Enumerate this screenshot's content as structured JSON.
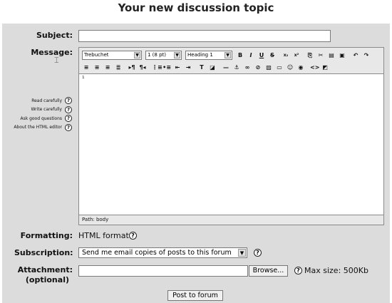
{
  "page": {
    "title": "Your new discussion topic"
  },
  "form": {
    "subject_label": "Subject:",
    "subject_value": "",
    "message_label": "Message:",
    "formatting_label": "Formatting:",
    "formatting_value": "HTML format",
    "subscription_label": "Subscription:",
    "subscription_value": "Send me email copies of posts to this forum",
    "attachment_label_1": "Attachment:",
    "attachment_label_2": "(optional)",
    "browse_label": "Browse...",
    "max_size": "Max size: 500Kb",
    "submit_label": "Post to forum"
  },
  "editor": {
    "font_family": "Trebuchet",
    "font_size": "1 (8 pt)",
    "heading": "Heading 1",
    "caret": "¹",
    "path": "Path:  body"
  },
  "help": {
    "items": [
      "Read carefully",
      "Write carefully",
      "Ask good questions",
      "About the HTML editor"
    ],
    "glyph": "?"
  },
  "icons": {
    "toolbar_row1": [
      "bold-icon",
      "italic-icon",
      "underline-icon",
      "strikethrough-icon",
      "subscript-icon",
      "superscript-icon",
      "copy-icon",
      "cut-icon",
      "paste-icon",
      "paste-word-icon",
      "undo-icon",
      "redo-icon"
    ],
    "toolbar_row2": [
      "align-left-icon",
      "align-center-icon",
      "align-right-icon",
      "justify-icon",
      "ltr-icon",
      "rtl-icon",
      "ordered-list-icon",
      "unordered-list-icon",
      "outdent-icon",
      "indent-icon",
      "text-color-icon",
      "background-color-icon",
      "horizontal-rule-icon",
      "anchor-icon",
      "link-icon",
      "unlink-icon",
      "image-icon",
      "table-icon",
      "smiley-icon",
      "spellcheck-icon",
      "html-source-icon",
      "fullscreen-icon"
    ]
  }
}
